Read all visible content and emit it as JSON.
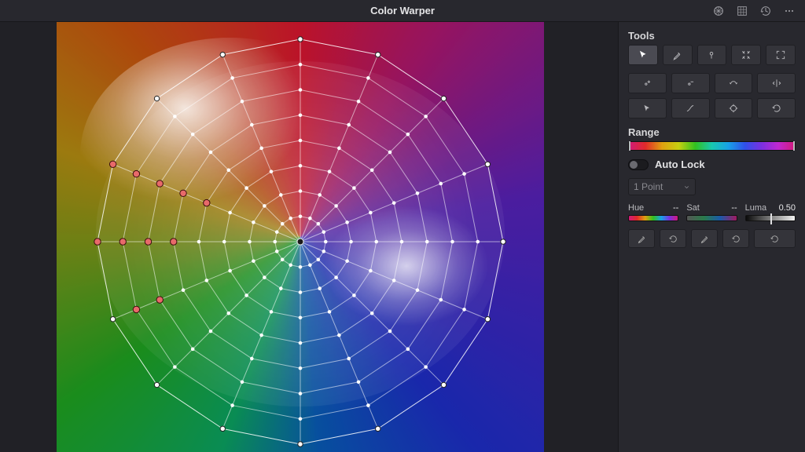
{
  "header": {
    "title": "Color Warper",
    "actions": [
      "scope-icon",
      "grid-icon",
      "history-icon",
      "more-icon"
    ]
  },
  "tools": {
    "title": "Tools",
    "row1": [
      "pointer",
      "dropper",
      "pin",
      "contract",
      "expand"
    ],
    "grid": [
      "add-point",
      "remove-point",
      "twirl",
      "mirror",
      "select-pointer",
      "curve",
      "target",
      "reset-rotate"
    ]
  },
  "range": {
    "title": "Range"
  },
  "autolock": {
    "label": "Auto Lock",
    "on": false,
    "select_value": "1 Point"
  },
  "sliders": {
    "hue": {
      "label": "Hue",
      "value": "--"
    },
    "sat": {
      "label": "Sat",
      "value": "--"
    },
    "luma": {
      "label": "Luma",
      "value": "0.50"
    }
  },
  "chart_data": {
    "type": "radar-grid",
    "title": "Hue-Saturation Warp Grid",
    "rings": 8,
    "spokes": 16,
    "hue_deg_per_spoke": 22.5,
    "center": "neutral gray",
    "outer": "full saturation",
    "selected_points": [
      {
        "ring": 7,
        "spoke": 11,
        "approx_hue_deg": 247.5
      },
      {
        "ring": 7,
        "spoke": 12,
        "approx_hue_deg": 270
      },
      {
        "ring": 6,
        "spoke": 12,
        "approx_hue_deg": 270
      },
      {
        "ring": 6,
        "spoke": 11,
        "approx_hue_deg": 247.5
      },
      {
        "ring": 5,
        "spoke": 12,
        "approx_hue_deg": 270
      },
      {
        "ring": 8,
        "spoke": 12,
        "approx_hue_deg": 270
      },
      {
        "ring": 8,
        "spoke": 13,
        "approx_hue_deg": 292.5
      },
      {
        "ring": 7,
        "spoke": 13,
        "approx_hue_deg": 292.5
      },
      {
        "ring": 6,
        "spoke": 13,
        "approx_hue_deg": 292.5
      },
      {
        "ring": 5,
        "spoke": 13,
        "approx_hue_deg": 292.5
      },
      {
        "ring": 4,
        "spoke": 13,
        "approx_hue_deg": 292.5
      }
    ],
    "selected_color": "#e86a6a"
  }
}
